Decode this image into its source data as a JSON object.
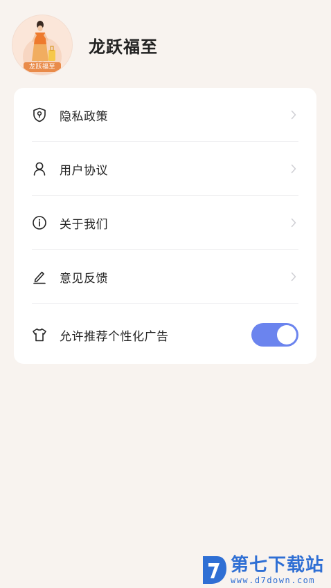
{
  "header": {
    "avatar_tag": "龙跃福至",
    "app_name": "龙跃福至"
  },
  "menu": {
    "items": [
      {
        "label": "隐私政策",
        "icon": "shield-icon"
      },
      {
        "label": "用户协议",
        "icon": "user-icon"
      },
      {
        "label": "关于我们",
        "icon": "info-icon"
      },
      {
        "label": "意见反馈",
        "icon": "pen-icon"
      }
    ],
    "ad_toggle": {
      "label": "允许推荐个性化广告",
      "icon": "shirt-icon",
      "on": true
    }
  },
  "watermark": {
    "title": "第七下载站",
    "url": "www.d7down.com"
  },
  "colors": {
    "background": "#f8f3ef",
    "card": "#ffffff",
    "toggle_on": "#6b84ee",
    "watermark": "#2f6fd4"
  }
}
